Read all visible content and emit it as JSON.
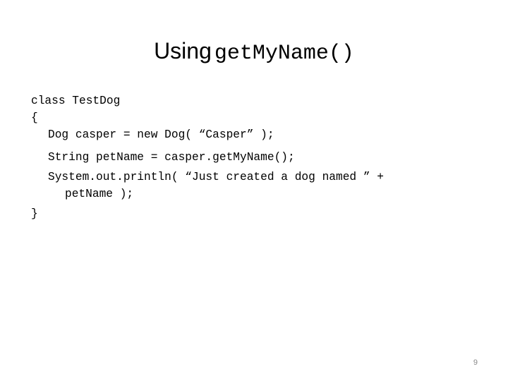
{
  "slide": {
    "title_word": "Using",
    "title_code": "getMyName()",
    "code_lines": [
      "class TestDog",
      "{",
      "Dog casper = new Dog( “Casper” );",
      "String petName = casper.getMyName();",
      "System.out.println( “Just created a dog named ” +",
      "petName );",
      "}"
    ],
    "page_number": "9"
  }
}
